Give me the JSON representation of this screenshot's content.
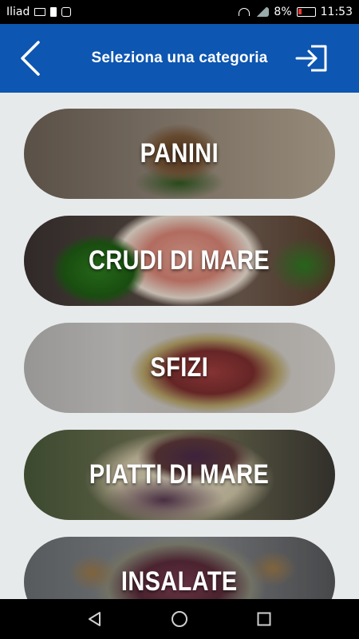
{
  "status_bar": {
    "carrier": "Iliad",
    "battery_percent": "8%",
    "time": "11:53",
    "icons": [
      "mail-icon",
      "warning-icon",
      "instagram-icon",
      "wifi-icon",
      "signal-icon",
      "battery-icon"
    ]
  },
  "header": {
    "title": "Seleziona una categoria",
    "background_color": "#0d56b1",
    "back_icon": "chevron-left-icon",
    "logout_icon": "logout-icon"
  },
  "categories": [
    {
      "label": "PANINI"
    },
    {
      "label": "CRUDI DI MARE"
    },
    {
      "label": "SFIZI"
    },
    {
      "label": "PIATTI DI MARE"
    },
    {
      "label": "INSALATE"
    }
  ],
  "nav_bar": {
    "icons": [
      "back-triangle-icon",
      "home-circle-icon",
      "recents-square-icon"
    ]
  }
}
